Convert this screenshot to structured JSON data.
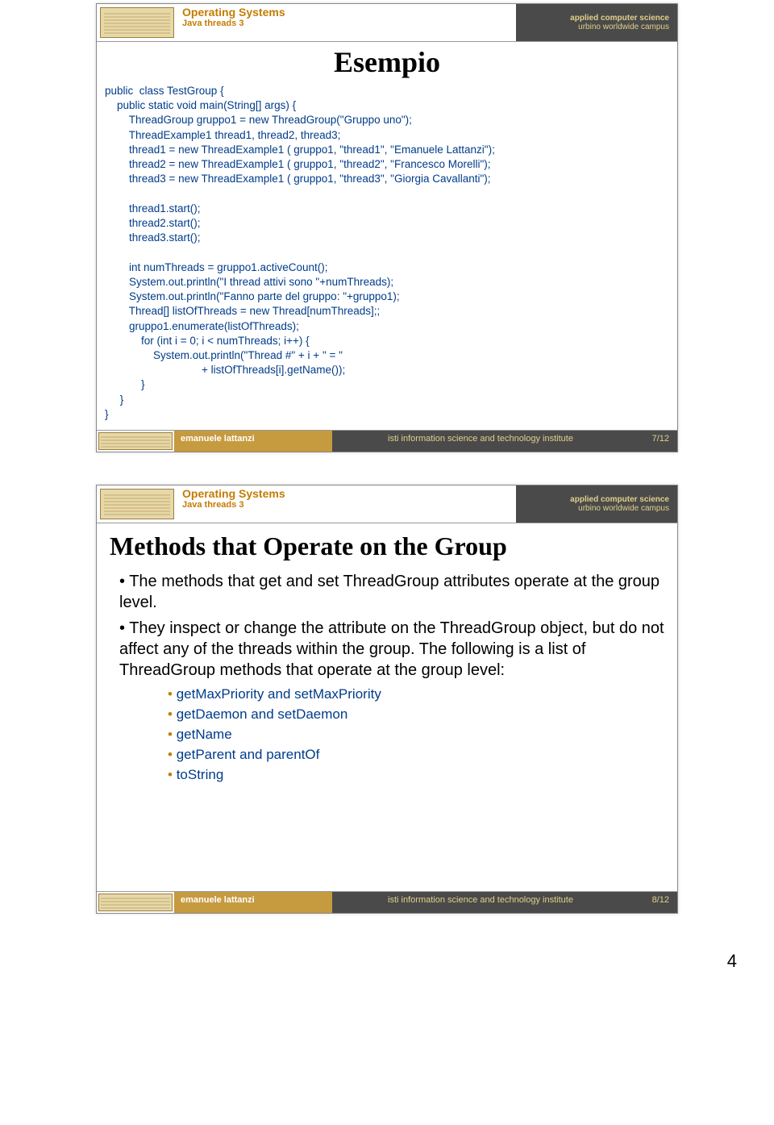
{
  "header": {
    "course": "Operating Systems",
    "subtitle": "Java threads 3",
    "dept1": "applied computer science",
    "dept2": "urbino worldwide campus"
  },
  "footer": {
    "author": "emanuele lattanzi",
    "institute": "isti information science and technology institute"
  },
  "slide1": {
    "title": "Esempio",
    "pageLabel": "7/12",
    "code": "public  class TestGroup {\n    public static void main(String[] args) {\n        ThreadGroup gruppo1 = new ThreadGroup(\"Gruppo uno\");\n        ThreadExample1 thread1, thread2, thread3;\n        thread1 = new ThreadExample1 ( gruppo1, \"thread1\", \"Emanuele Lattanzi\");\n        thread2 = new ThreadExample1 ( gruppo1, \"thread2\", \"Francesco Morelli\");\n        thread3 = new ThreadExample1 ( gruppo1, \"thread3\", \"Giorgia Cavallanti\");\n\n        thread1.start();\n        thread2.start();\n        thread3.start();\n\n        int numThreads = gruppo1.activeCount();\n        System.out.println(\"I thread attivi sono \"+numThreads);\n        System.out.println(\"Fanno parte del gruppo: \"+gruppo1);\n        Thread[] listOfThreads = new Thread[numThreads];;\n        gruppo1.enumerate(listOfThreads);\n            for (int i = 0; i < numThreads; i++) {\n                System.out.println(\"Thread #\" + i + \" = \"\n                                + listOfThreads[i].getName());\n            }\n     }\n}"
  },
  "slide2": {
    "title": "Methods that Operate on the Group",
    "pageLabel": "8/12",
    "bullets": [
      "The methods that get and set ThreadGroup attributes operate at the group level.",
      "They inspect or change the attribute on the ThreadGroup object, but do not affect any of the threads within the group. The following is a list of ThreadGroup methods that operate at the group level:"
    ],
    "subBullets": [
      "getMaxPriority and setMaxPriority",
      "getDaemon and setDaemon",
      "getName",
      "getParent and parentOf",
      "toString"
    ]
  },
  "handoutPage": "4"
}
